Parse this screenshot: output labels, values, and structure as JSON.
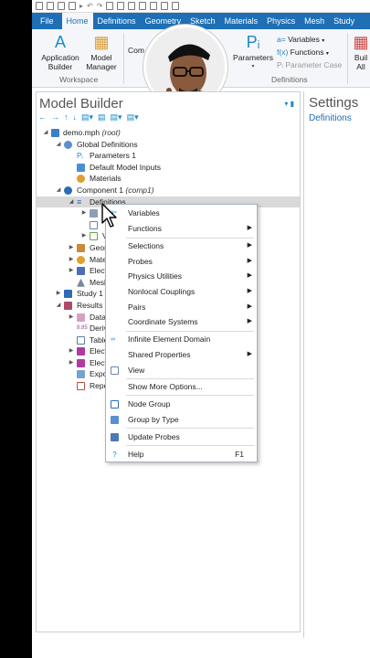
{
  "menu_tabs": [
    "File",
    "Home",
    "Definitions",
    "Geometry",
    "Sketch",
    "Materials",
    "Physics",
    "Mesh",
    "Study"
  ],
  "ribbon": {
    "application_builder": "Application\nBuilder",
    "model_manager": "Model\nManager",
    "comp_partial": "Com",
    "workspace_label": "Workspace",
    "parameters": "Parameters",
    "variables": "Variables",
    "functions": "Functions",
    "parameter_case": "Parameter Case",
    "definitions_label": "Definitions",
    "build_partial_1": "Buil",
    "build_partial_2": "All"
  },
  "model_builder": {
    "title": "Model Builder",
    "tree": {
      "root": "demo.mph",
      "root_sub": "(root)",
      "global_definitions": "Global Definitions",
      "parameters_1": "Parameters 1",
      "default_model_inputs": "Default Model Inputs",
      "materials_global": "Materials",
      "component_1": "Component 1",
      "component_1_sub": "(comp1)",
      "definitions": "Definitions",
      "v_partial": "V",
      "geom_partial": "Geor",
      "mate_partial": "Mate",
      "elec_partial_1": "Elect",
      "mesh_partial": "Mesl",
      "study_1": "Study 1",
      "results": "Results",
      "data_partial": "Data",
      "deriv_partial": "Deriv",
      "table_partial": "Table",
      "elec_partial_2": "Elect",
      "elec_partial_3": "Elect",
      "expo_partial": "Expo",
      "repo_partial": "Repo"
    }
  },
  "settings": {
    "title": "Settings",
    "subtitle": "Definitions"
  },
  "context_menu": {
    "variables": "Variables",
    "functions": "Functions",
    "selections": "Selections",
    "probes": "Probes",
    "physics_utilities": "Physics Utilities",
    "nonlocal_couplings": "Nonlocal Couplings",
    "pairs": "Pairs",
    "coordinate_systems": "Coordinate Systems",
    "infinite_element_domain": "Infinite Element Domain",
    "shared_properties": "Shared Properties",
    "view": "View",
    "show_more_options": "Show More Options...",
    "node_group": "Node Group",
    "group_by_type": "Group by Type",
    "update_probes": "Update Probes",
    "help": "Help",
    "help_shortcut": "F1"
  },
  "colors": {
    "tab_bar": "#1e6fb5",
    "accent": "#1e88c8",
    "selection": "#d9d9d9"
  }
}
